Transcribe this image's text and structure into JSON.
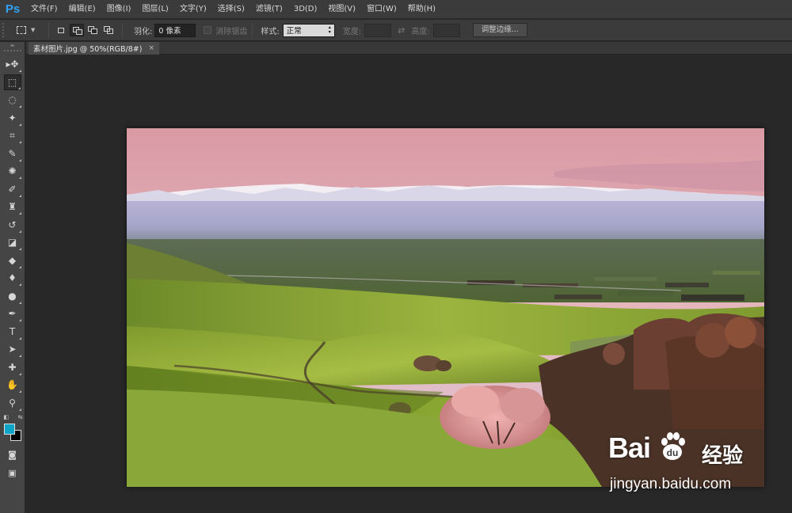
{
  "app": {
    "logo": "Ps"
  },
  "menu": [
    "文件(F)",
    "编辑(E)",
    "图像(I)",
    "图层(L)",
    "文字(Y)",
    "选择(S)",
    "滤镜(T)",
    "3D(D)",
    "视图(V)",
    "窗口(W)",
    "帮助(H)"
  ],
  "options": {
    "feather_label": "羽化:",
    "feather_value": "0 像素",
    "antialias_label": "消除锯齿",
    "style_label": "样式:",
    "style_value": "正常",
    "width_label": "宽度:",
    "height_label": "高度:",
    "refine_edge": "调整边缘..."
  },
  "document": {
    "tab_title": "素材图片.jpg @ 50%(RGB/8#)",
    "close_glyph": "×"
  },
  "toolbar": {
    "collapse_glyph": "▸▸",
    "tools": [
      {
        "name": "move-tool",
        "glyph": "▸✥"
      },
      {
        "name": "rectangular-marquee-tool",
        "glyph": "⬚",
        "active": true
      },
      {
        "name": "lasso-tool",
        "glyph": "◌"
      },
      {
        "name": "magic-wand-tool",
        "glyph": "✦"
      },
      {
        "name": "crop-tool",
        "glyph": "⌗"
      },
      {
        "name": "eyedropper-tool",
        "glyph": "✎"
      },
      {
        "name": "spot-healing-tool",
        "glyph": "✺"
      },
      {
        "name": "brush-tool",
        "glyph": "✐"
      },
      {
        "name": "clone-stamp-tool",
        "glyph": "♜"
      },
      {
        "name": "history-brush-tool",
        "glyph": "↺"
      },
      {
        "name": "eraser-tool",
        "glyph": "◪"
      },
      {
        "name": "paint-bucket-tool",
        "glyph": "◆"
      },
      {
        "name": "blur-tool",
        "glyph": "♦"
      },
      {
        "name": "dodge-tool",
        "glyph": "●"
      },
      {
        "name": "pen-tool",
        "glyph": "✒"
      },
      {
        "name": "type-tool",
        "glyph": "T"
      },
      {
        "name": "path-selection-tool",
        "glyph": "➤"
      },
      {
        "name": "custom-shape-tool",
        "glyph": "✚"
      },
      {
        "name": "hand-tool",
        "glyph": "✋"
      },
      {
        "name": "zoom-tool",
        "glyph": "⚲"
      }
    ],
    "default_colors_glyph": "◧",
    "swap_colors_glyph": "⇆",
    "quick_mask_glyph": "◙",
    "screen_mode_glyph": "▣",
    "foreground_color": "#0da5c7",
    "background_color": "#000000"
  },
  "watermark": {
    "brand": "Bai",
    "brand_cn": "经验",
    "url": "jingyan.baidu.com"
  }
}
